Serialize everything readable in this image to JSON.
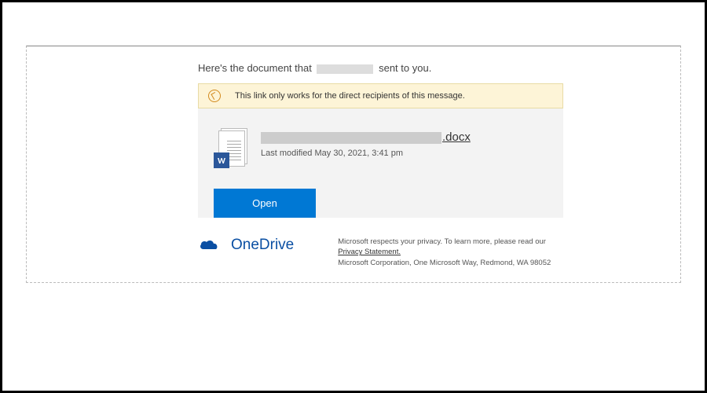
{
  "header": {
    "prefix": "Here's the document that",
    "suffix": "sent to you."
  },
  "notice": {
    "text": "This link only works for the direct recipients of this message."
  },
  "document": {
    "badge_letter": "W",
    "extension": ".docx",
    "last_modified_prefix": "Last modified",
    "last_modified_value": "May 30, 2021, 3:41 pm"
  },
  "actions": {
    "open_label": "Open"
  },
  "footer": {
    "brand": "OneDrive",
    "legal_line1": "Microsoft respects your privacy. To learn more, please read our",
    "privacy_link": "Privacy Statement.",
    "legal_line2": "Microsoft Corporation, One Microsoft Way, Redmond, WA 98052"
  }
}
